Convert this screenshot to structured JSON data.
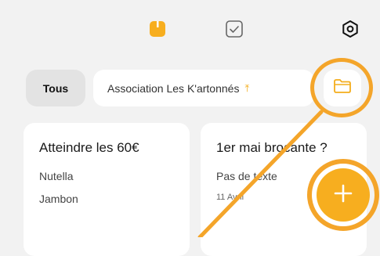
{
  "topbar": {
    "icons": [
      "notes-icon",
      "checklist-icon",
      "settings-icon"
    ],
    "accent": "#f7ae1f"
  },
  "filters": {
    "all_label": "Tous",
    "association_label": "Association Les K'artonnés",
    "sort_symbol": "⤒"
  },
  "cards": [
    {
      "title": "Atteindre les 60€",
      "lines": [
        "Nutella",
        "Jambon"
      ],
      "date": ""
    },
    {
      "title": "1er mai brocante ?",
      "lines": [
        "Pas de texte"
      ],
      "date": "11 Avril"
    }
  ],
  "fab": {
    "symbol": "+"
  },
  "colors": {
    "accent": "#f7ae1f",
    "highlight": "#f4a52a",
    "background": "#f2f2f2",
    "card": "#ffffff"
  }
}
